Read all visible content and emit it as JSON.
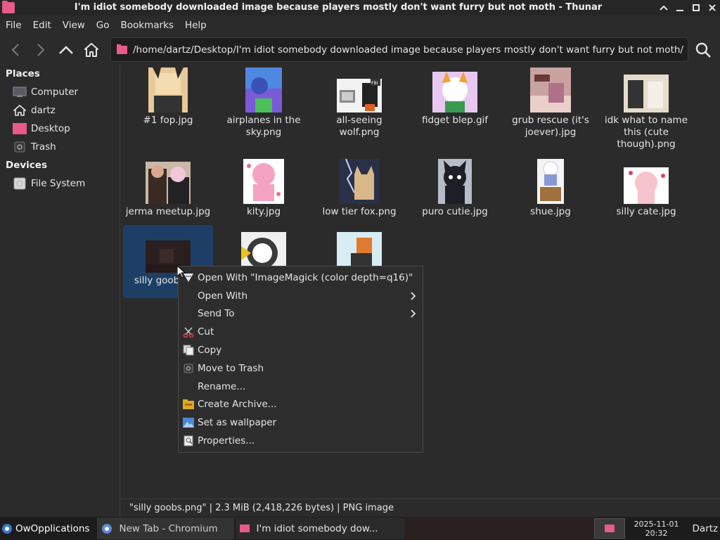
{
  "window": {
    "title": "I'm idiot somebody downloaded image because players mostly don't want furry but not moth - Thunar"
  },
  "menubar": [
    "File",
    "Edit",
    "View",
    "Go",
    "Bookmarks",
    "Help"
  ],
  "location": {
    "path": "/home/dartz/Desktop/I'm idiot somebody downloaded image because players mostly don't want furry but not moth/"
  },
  "sidebar": {
    "places_header": "Places",
    "places": [
      "Computer",
      "dartz",
      "Desktop",
      "Trash"
    ],
    "devices_header": "Devices",
    "devices": [
      "File System"
    ]
  },
  "files": [
    {
      "name": "#1 fop.jpg"
    },
    {
      "name": "airplanes in the sky.png"
    },
    {
      "name": "all-seeing wolf.png"
    },
    {
      "name": "fidget blep.gif"
    },
    {
      "name": "grub rescue (it's joever).jpg"
    },
    {
      "name": "idk what to name this (cute though).png"
    },
    {
      "name": "jerma meetup.jpg"
    },
    {
      "name": "kity.jpg"
    },
    {
      "name": "low tier fox.png"
    },
    {
      "name": "puro cutie.jpg"
    },
    {
      "name": "shue.jpg"
    },
    {
      "name": "silly cate.jpg"
    },
    {
      "name": "silly goob"
    },
    {
      "name": ""
    },
    {
      "name": ""
    }
  ],
  "thumb_labels": {
    "wolf_badge": "FBI"
  },
  "context_menu": [
    {
      "label": "Open With \"ImageMagick (color depth=q16)\"",
      "icon": "imagemagick-icon",
      "submenu": false
    },
    {
      "label": "Open With",
      "icon": "",
      "submenu": true
    },
    {
      "label": "Send To",
      "icon": "",
      "submenu": true
    },
    {
      "label": "Cut",
      "icon": "scissors-icon",
      "submenu": false
    },
    {
      "label": "Copy",
      "icon": "copy-icon",
      "submenu": false
    },
    {
      "label": "Move to Trash",
      "icon": "trash-icon",
      "submenu": false
    },
    {
      "label": "Rename...",
      "icon": "",
      "submenu": false
    },
    {
      "label": "Create Archive...",
      "icon": "archive-icon",
      "submenu": false
    },
    {
      "label": "Set as wallpaper",
      "icon": "wallpaper-icon",
      "submenu": false
    },
    {
      "label": "Properties...",
      "icon": "properties-icon",
      "submenu": false
    }
  ],
  "statusbar": {
    "text": "\"silly goobs.png\"  |  2.3 MiB (2,418,226 bytes)  |  PNG image"
  },
  "taskbar": {
    "start_label": "OwOpplications",
    "tasks": [
      "New Tab - Chromium",
      "I'm idiot somebody dow..."
    ],
    "date": "2025-11-01",
    "time": "20:32",
    "user": "Dartz"
  },
  "colors": {
    "accent": "#e85a8a",
    "selection": "#1d3f66",
    "background": "#2b2b2b"
  }
}
